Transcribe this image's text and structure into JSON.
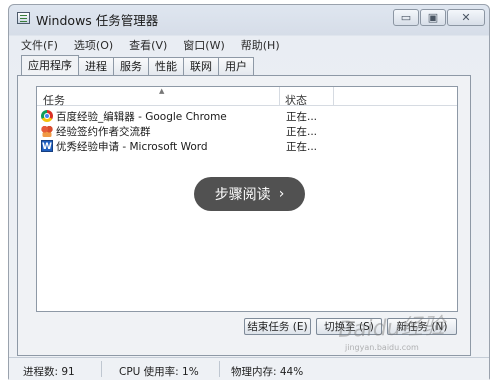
{
  "window": {
    "title": "Windows 任务管理器"
  },
  "window_buttons": {
    "minimize": "▭",
    "maximize": "▣",
    "close": "✕"
  },
  "menu": [
    "文件(F)",
    "选项(O)",
    "查看(V)",
    "窗口(W)",
    "帮助(H)"
  ],
  "tabs": [
    "应用程序",
    "进程",
    "服务",
    "性能",
    "联网",
    "用户"
  ],
  "active_tab": "应用程序",
  "list": {
    "columns": {
      "task": "任务",
      "status": "状态"
    },
    "rows": [
      {
        "icon": "chrome-icon",
        "name": "百度经验_编辑器 - Google Chrome",
        "status": "正在..."
      },
      {
        "icon": "qq-group-icon",
        "name": "经验签约作者交流群",
        "status": "正在..."
      },
      {
        "icon": "word-icon",
        "name": "优秀经验申请 - Microsoft Word",
        "status": "正在..."
      }
    ]
  },
  "overlay": {
    "label": "步骤阅读",
    "arrow": "›"
  },
  "buttons": {
    "end_task": "结束任务 (E)",
    "switch_to": "切换至 (S)",
    "new_task": "新任务 (N)"
  },
  "statusbar": {
    "processes": "进程数: 91",
    "cpu": "CPU 使用率: 1%",
    "memory": "物理内存: 44%"
  },
  "watermark": {
    "logo": "Baidu经验",
    "url": "jingyan.baidu.com"
  }
}
